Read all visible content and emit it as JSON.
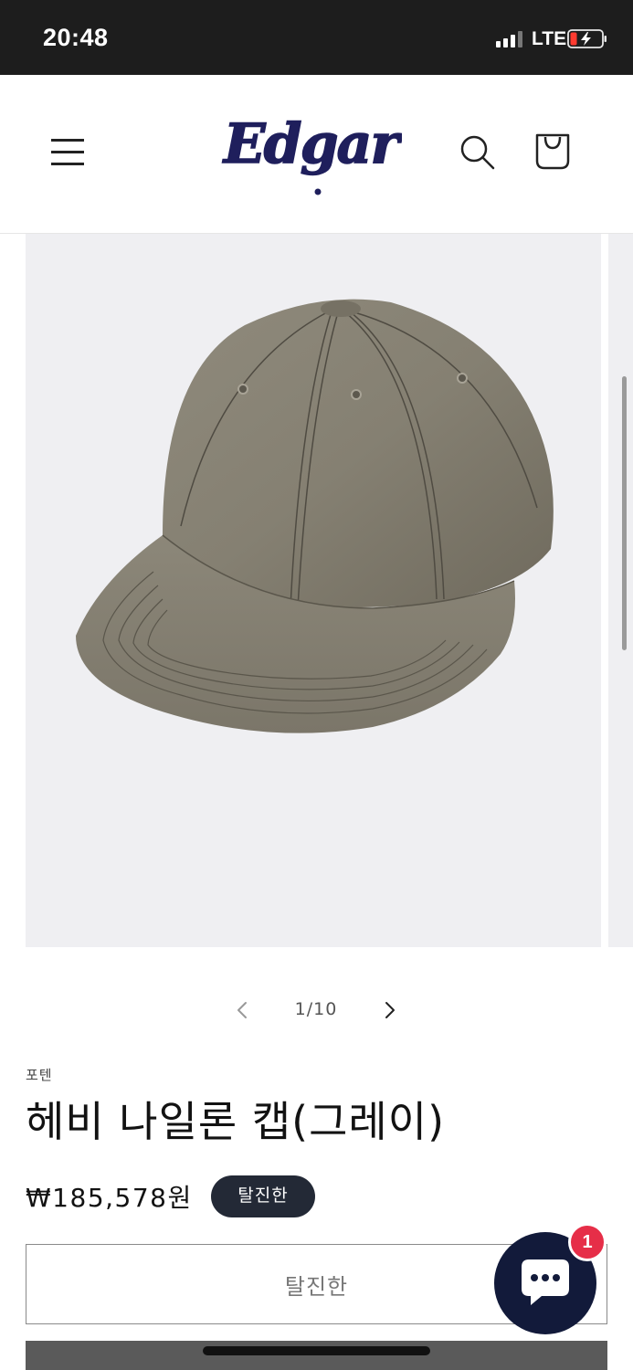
{
  "status_bar": {
    "time": "20:48",
    "network": "LTE",
    "battery_level": 0.15,
    "signal_bars": 3
  },
  "header": {
    "logo_text": "Edgar",
    "menu_icon": "hamburger-menu-icon",
    "search_icon": "search-icon",
    "cart_icon": "shopping-bag-icon"
  },
  "gallery": {
    "current": "1/10",
    "prev_icon": "chevron-left-icon",
    "next_icon": "chevron-right-icon",
    "image_subject": "hat-image"
  },
  "product": {
    "vendor": "포텐",
    "title": "헤비 나일론 캡(그레이)",
    "price": "₩185,578원",
    "badge": "탈진한",
    "button_label": "탈진한"
  },
  "chat": {
    "unread_count": "1",
    "icon": "chat-bubble-icon"
  },
  "colors": {
    "header_bg": "#ffffff",
    "status_bg": "#1d1d1d",
    "badge_bg": "#232936",
    "chat_bg": "#121a3a",
    "chat_badge": "#e62e48",
    "logo_color": "#1f1f5c"
  }
}
